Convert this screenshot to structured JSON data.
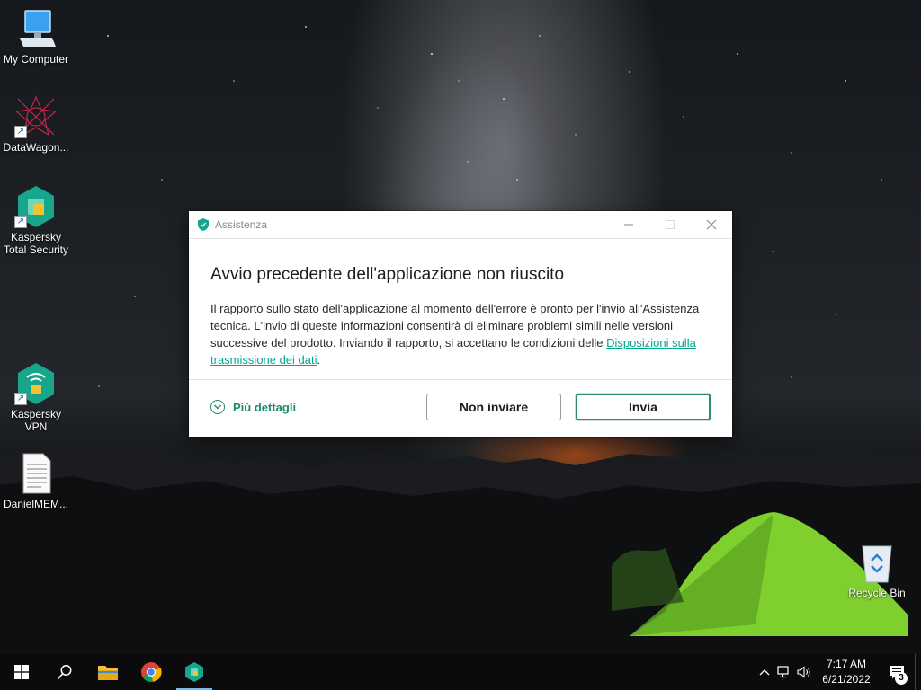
{
  "desktop": {
    "icons": [
      {
        "label": "My Computer",
        "icon": "computer-icon"
      },
      {
        "label": "DataWagon...",
        "icon": "datawagon-icon"
      },
      {
        "label": "Kaspersky Total Security",
        "icon": "kaspersky-total-security-icon"
      },
      {
        "label": "Kaspersky VPN",
        "icon": "kaspersky-vpn-icon"
      },
      {
        "label": "DanielMEM...",
        "icon": "text-document-icon"
      },
      {
        "label": "Recycle Bin",
        "icon": "recycle-bin-icon"
      }
    ]
  },
  "dialog": {
    "title": "Assistenza",
    "heading": "Avvio precedente dell'applicazione non riuscito",
    "message": "Il rapporto sullo stato dell'applicazione al momento dell'errore è pronto per l'invio all'Assistenza tecnica. L'invio di queste informazioni consentirà di eliminare problemi simili nelle versioni successive del prodotto. Inviando il rapporto, si accettano le condizioni delle",
    "link": "Disposizioni sulla trasmissione dei dati",
    "link_suffix": ".",
    "details_label": "Più dettagli",
    "cancel_label": "Non inviare",
    "send_label": "Invia",
    "accent_color": "#2e8a6e"
  },
  "taskbar": {
    "apps": [
      "windows-start-icon",
      "search-icon",
      "file-explorer-icon",
      "chrome-icon",
      "kaspersky-icon"
    ],
    "time": "7:17 AM",
    "date": "6/21/2022",
    "notification_count": "3"
  }
}
